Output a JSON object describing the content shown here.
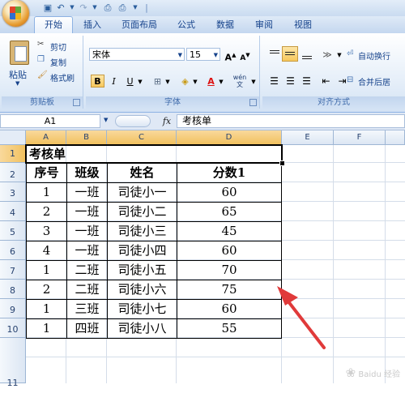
{
  "ribbon": {
    "tabs": [
      "开始",
      "插入",
      "页面布局",
      "公式",
      "数据",
      "审阅",
      "视图"
    ],
    "clipboard": {
      "paste": "粘贴",
      "cut": "剪切",
      "copy": "复制",
      "format_painter": "格式刷",
      "group": "剪贴板"
    },
    "font": {
      "family": "宋体",
      "size": "15",
      "group": "字体",
      "bold_active": true
    },
    "alignment": {
      "wrap": "自动换行",
      "merge": "合并后居",
      "group": "对齐方式"
    }
  },
  "formula_bar": {
    "name_box": "A1",
    "fx": "fx",
    "content": "考核单"
  },
  "sheet": {
    "columns": [
      "A",
      "B",
      "C",
      "D",
      "E",
      "F"
    ],
    "rows": [
      "1",
      "2",
      "3",
      "4",
      "5",
      "6",
      "7",
      "8",
      "9",
      "10",
      "11"
    ],
    "title": "考核单",
    "headers": [
      "序号",
      "班级",
      "姓名",
      "分数1"
    ],
    "data": [
      [
        "1",
        "一班",
        "司徒小一",
        "60"
      ],
      [
        "2",
        "一班",
        "司徒小二",
        "65"
      ],
      [
        "3",
        "一班",
        "司徒小三",
        "45"
      ],
      [
        "4",
        "一班",
        "司徒小四",
        "60"
      ],
      [
        "1",
        "二班",
        "司徒小五",
        "70"
      ],
      [
        "2",
        "二班",
        "司徒小六",
        "75"
      ],
      [
        "1",
        "三班",
        "司徒小七",
        "60"
      ],
      [
        "1",
        "四班",
        "司徒小八",
        "55"
      ]
    ]
  },
  "watermark": "Baidu 经验",
  "colors": {
    "accent": "#e03a3a",
    "ribbon": "#dfe8f5",
    "selection": "#f1c15f"
  }
}
